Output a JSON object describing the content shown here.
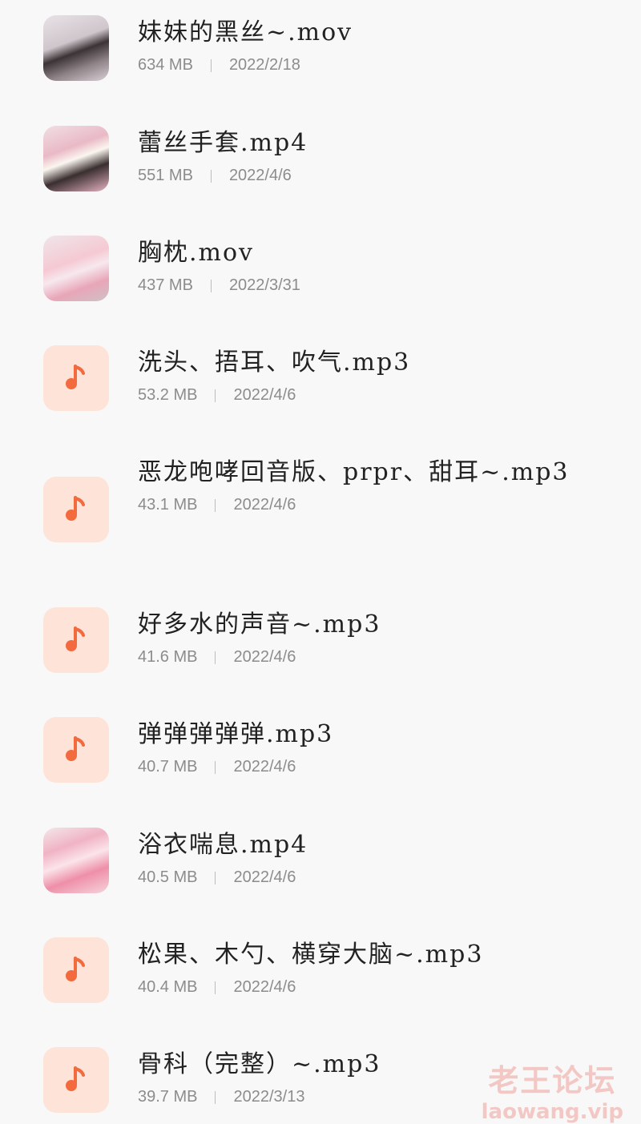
{
  "files": [
    {
      "name": "妹妹的黑丝~.mov",
      "size": "634 MB",
      "date": "2022/2/18",
      "type": "video"
    },
    {
      "name": "蕾丝手套.mp4",
      "size": "551 MB",
      "date": "2022/4/6",
      "type": "video"
    },
    {
      "name": "胸枕.mov",
      "size": "437 MB",
      "date": "2022/3/31",
      "type": "video"
    },
    {
      "name": "洗头、捂耳、吹气.mp3",
      "size": "53.2 MB",
      "date": "2022/4/6",
      "type": "audio"
    },
    {
      "name": "恶龙咆哮回音版、prpr、甜耳~.mp3",
      "size": "43.1 MB",
      "date": "2022/4/6",
      "type": "audio"
    },
    {
      "name": "好多水的声音~.mp3",
      "size": "41.6 MB",
      "date": "2022/4/6",
      "type": "audio"
    },
    {
      "name": "弹弹弹弹弹.mp3",
      "size": "40.7 MB",
      "date": "2022/4/6",
      "type": "audio"
    },
    {
      "name": "浴衣喘息.mp4",
      "size": "40.5 MB",
      "date": "2022/4/6",
      "type": "video"
    },
    {
      "name": "松果、木勺、横穿大脑~.mp3",
      "size": "40.4 MB",
      "date": "2022/4/6",
      "type": "audio"
    },
    {
      "name": "骨科（完整）~.mp3",
      "size": "39.7 MB",
      "date": "2022/3/13",
      "type": "audio"
    }
  ],
  "watermark": {
    "cn": "老王论坛",
    "en": "laowang.vip"
  },
  "colors": {
    "audio_icon_bg": "#fde3d8",
    "audio_icon": "#f26a3d",
    "meta_text": "#8c8c8c"
  }
}
